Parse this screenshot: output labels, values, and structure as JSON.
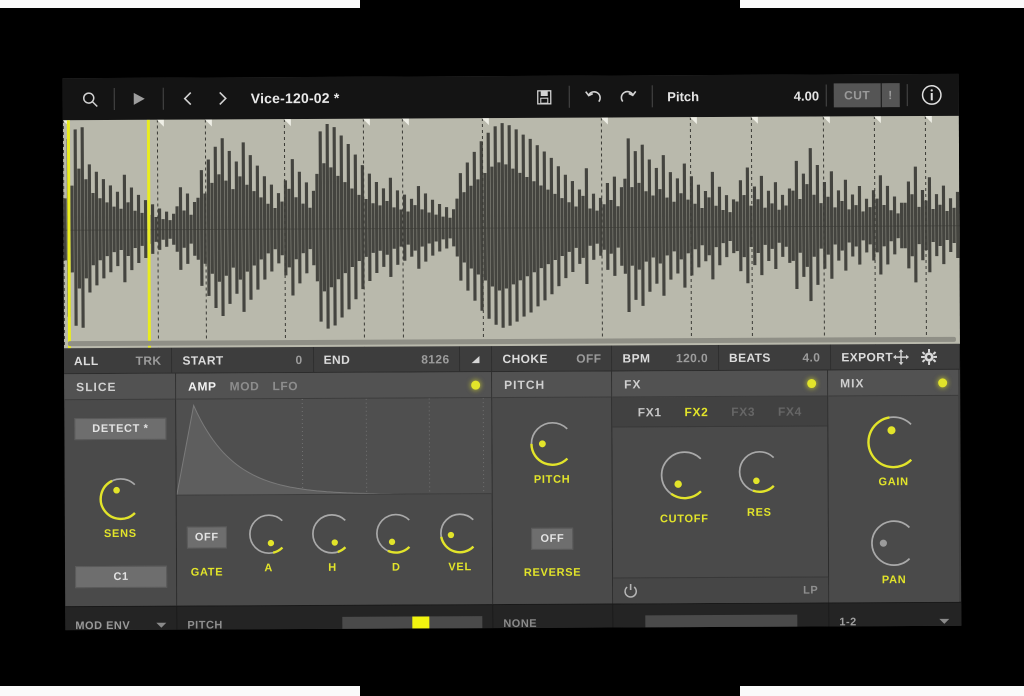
{
  "app": {
    "title": "Vice-120-02 *"
  },
  "topbar": {
    "search_icon": "search-icon",
    "play_icon": "play-icon",
    "prev_icon": "chevron-left-icon",
    "next_icon": "chevron-right-icon",
    "save_icon": "save-icon",
    "undo_icon": "undo-icon",
    "redo_icon": "redo-icon",
    "param_name": "Pitch",
    "param_value": "4.00",
    "cut_label": "CUT",
    "bang_label": "!",
    "info_icon": "info-icon"
  },
  "strip": {
    "all_label": "ALL",
    "trk_label": "TRK",
    "start_label": "START",
    "start_value": "0",
    "end_label": "END",
    "end_value": "8126",
    "flag_icon": "flag-icon",
    "choke_label": "CHOKE",
    "choke_value": "OFF",
    "bpm_label": "BPM",
    "bpm_value": "120.0",
    "beats_label": "BEATS",
    "beats_value": "4.0",
    "export_label": "EXPORT",
    "move_icon": "move-icon",
    "gear_icon": "gear-icon"
  },
  "slice": {
    "title": "SLICE",
    "detect_label": "DETECT *",
    "sens_label": "SENS",
    "sens_value": 0.74,
    "note_label": "C1"
  },
  "envelope": {
    "tabs": [
      {
        "label": "AMP",
        "active": true
      },
      {
        "label": "MOD",
        "active": false
      },
      {
        "label": "LFO",
        "active": false
      }
    ],
    "gate_label": "GATE",
    "gate_value": "OFF",
    "knobs": [
      {
        "label": "A",
        "value": 0.12
      },
      {
        "label": "H",
        "value": 0.1
      },
      {
        "label": "D",
        "value": 0.26
      },
      {
        "label": "VEL",
        "value": 0.46
      }
    ]
  },
  "pitch": {
    "title": "PITCH",
    "knob_label": "PITCH",
    "knob_value": 0.5,
    "reverse_label": "REVERSE",
    "reverse_value": "OFF"
  },
  "fx": {
    "title": "FX",
    "tabs": [
      {
        "label": "FX1",
        "state": "lit"
      },
      {
        "label": "FX2",
        "state": "on"
      },
      {
        "label": "FX3",
        "state": "dim"
      },
      {
        "label": "FX4",
        "state": "dim"
      }
    ],
    "knobs": [
      {
        "label": "CUTOFF",
        "value": 0.3
      },
      {
        "label": "RES",
        "value": 0.24
      }
    ],
    "power_icon": "power-icon",
    "mode_label": "LP"
  },
  "mix": {
    "title": "MIX",
    "gain_label": "GAIN",
    "gain_value": 0.8,
    "pan_label": "PAN",
    "pan_value": 0.5
  },
  "bottombar": {
    "source_label": "MOD ENV",
    "dest_label": "PITCH",
    "depth_value": 0.62,
    "none_label": "NONE",
    "output_label": "1-2"
  },
  "colors": {
    "accent": "#e2e42a",
    "slider_fill": "#f2f40f",
    "panel_bg": "#4a4a4a",
    "topbar_bg": "#141414",
    "waveform_bg": "#b9b9ac",
    "waveform_fg": "#3a3a35"
  },
  "waveform": {
    "slice_markers": [
      0.0,
      0.105,
      0.158,
      0.247,
      0.335,
      0.378,
      0.468,
      0.6,
      0.7,
      0.768,
      0.848,
      0.905,
      0.962
    ],
    "selection_start": 0.004,
    "selection_end": 0.094,
    "peaks": [
      0.3,
      0.86,
      0.42,
      0.95,
      0.58,
      0.97,
      0.48,
      0.62,
      0.35,
      0.55,
      0.3,
      0.48,
      0.26,
      0.42,
      0.22,
      0.36,
      0.2,
      0.52,
      0.26,
      0.4,
      0.18,
      0.33,
      0.16,
      0.28,
      0.14,
      0.24,
      0.12,
      0.2,
      0.1,
      0.17,
      0.09,
      0.15,
      0.22,
      0.4,
      0.18,
      0.34,
      0.14,
      0.26,
      0.3,
      0.56,
      0.34,
      0.66,
      0.44,
      0.78,
      0.52,
      0.86,
      0.46,
      0.74,
      0.38,
      0.64,
      0.5,
      0.82,
      0.42,
      0.7,
      0.36,
      0.6,
      0.3,
      0.5,
      0.24,
      0.42,
      0.2,
      0.34,
      0.26,
      0.46,
      0.38,
      0.66,
      0.3,
      0.54,
      0.24,
      0.44,
      0.2,
      0.36,
      0.52,
      0.92,
      0.62,
      0.99,
      0.58,
      0.96,
      0.5,
      0.88,
      0.44,
      0.8,
      0.38,
      0.7,
      0.32,
      0.6,
      0.28,
      0.52,
      0.24,
      0.44,
      0.22,
      0.38,
      0.26,
      0.48,
      0.2,
      0.36,
      0.18,
      0.32,
      0.16,
      0.28,
      0.22,
      0.4,
      0.18,
      0.33,
      0.15,
      0.27,
      0.13,
      0.23,
      0.11,
      0.2,
      0.1,
      0.18,
      0.28,
      0.52,
      0.34,
      0.62,
      0.4,
      0.72,
      0.46,
      0.82,
      0.52,
      0.9,
      0.58,
      0.96,
      0.62,
      0.99,
      0.6,
      0.97,
      0.56,
      0.93,
      0.52,
      0.88,
      0.48,
      0.84,
      0.44,
      0.78,
      0.4,
      0.72,
      0.36,
      0.66,
      0.32,
      0.58,
      0.28,
      0.5,
      0.24,
      0.44,
      0.2,
      0.36,
      0.3,
      0.56,
      0.18,
      0.32,
      0.16,
      0.28,
      0.22,
      0.42,
      0.26,
      0.48,
      0.2,
      0.38,
      0.46,
      0.84,
      0.38,
      0.72,
      0.42,
      0.78,
      0.34,
      0.64,
      0.3,
      0.56,
      0.36,
      0.68,
      0.28,
      0.52,
      0.24,
      0.46,
      0.32,
      0.6,
      0.26,
      0.48,
      0.22,
      0.4,
      0.18,
      0.34,
      0.28,
      0.52,
      0.2,
      0.38,
      0.16,
      0.3,
      0.14,
      0.26,
      0.24,
      0.44,
      0.3,
      0.56,
      0.2,
      0.38,
      0.26,
      0.48,
      0.18,
      0.34,
      0.22,
      0.42,
      0.16,
      0.3,
      0.2,
      0.36,
      0.34,
      0.62,
      0.26,
      0.5,
      0.4,
      0.74,
      0.3,
      0.58,
      0.22,
      0.42,
      0.28,
      0.52,
      0.18,
      0.34,
      0.24,
      0.44,
      0.16,
      0.3,
      0.2,
      0.38,
      0.14,
      0.26,
      0.18,
      0.34,
      0.26,
      0.48,
      0.2,
      0.38,
      0.15,
      0.28,
      0.12,
      0.22,
      0.22,
      0.42,
      0.3,
      0.56,
      0.18,
      0.34,
      0.24,
      0.46,
      0.16,
      0.3,
      0.2,
      0.38,
      0.14,
      0.26,
      0.17,
      0.32
    ]
  },
  "env_curve": {
    "attack": 0.055,
    "peak": 1.0,
    "decay_rate": 7.5
  }
}
